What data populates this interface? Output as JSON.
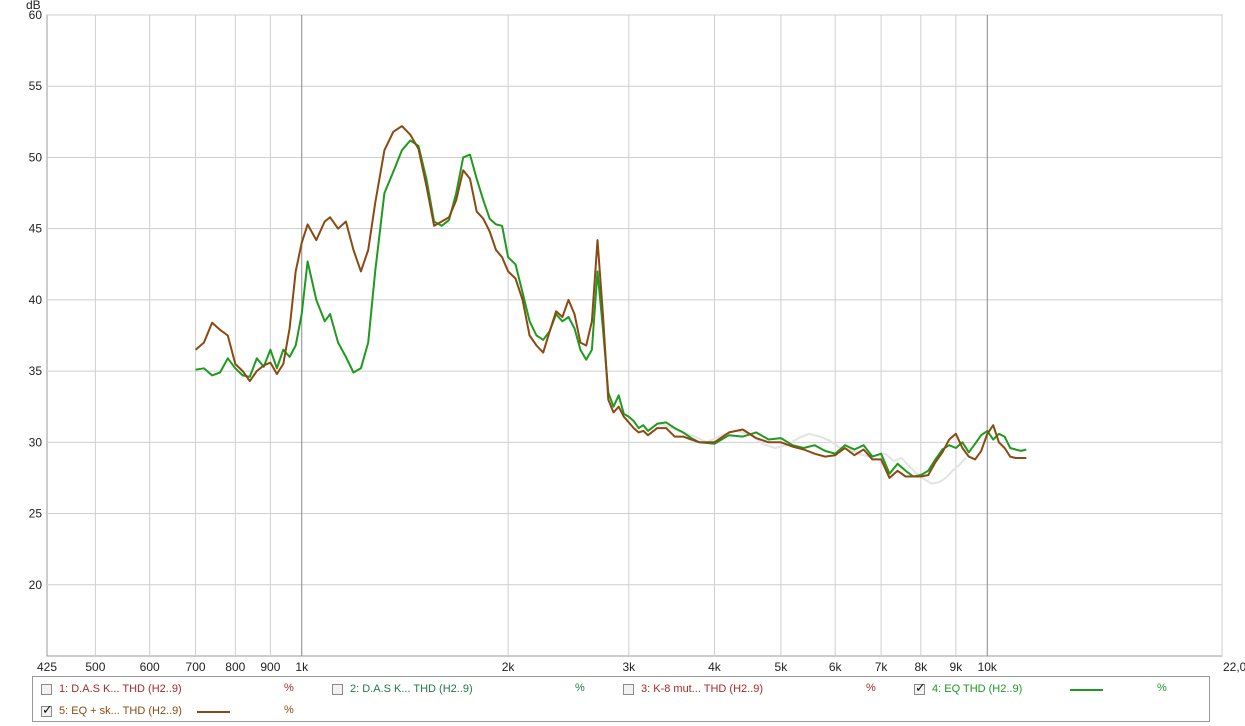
{
  "chart_data": {
    "type": "line",
    "ylabel": "dB",
    "ylim": [
      15,
      60
    ],
    "xlim": [
      425,
      22000
    ],
    "x_scale": "log",
    "grid": true,
    "y_ticks": [
      20,
      25,
      30,
      35,
      40,
      45,
      50,
      55,
      60
    ],
    "x_ticks": [
      {
        "value": 425,
        "label": "425"
      },
      {
        "value": 500,
        "label": "500"
      },
      {
        "value": 600,
        "label": "600"
      },
      {
        "value": 700,
        "label": "700"
      },
      {
        "value": 800,
        "label": "800"
      },
      {
        "value": 900,
        "label": "900"
      },
      {
        "value": 1000,
        "label": "1k"
      },
      {
        "value": 2000,
        "label": "2k"
      },
      {
        "value": 3000,
        "label": "3k"
      },
      {
        "value": 4000,
        "label": "4k"
      },
      {
        "value": 5000,
        "label": "5k"
      },
      {
        "value": 6000,
        "label": "6k"
      },
      {
        "value": 7000,
        "label": "7k"
      },
      {
        "value": 8000,
        "label": "8k"
      },
      {
        "value": 9000,
        "label": "9k"
      },
      {
        "value": 10000,
        "label": "10k"
      },
      {
        "value": 22000,
        "label": "22,0kHz"
      }
    ],
    "series": [
      {
        "name": "4: EQ THD (H2..9)",
        "color": "#1f9a1f",
        "x": [
          700,
          720,
          740,
          760,
          780,
          800,
          820,
          840,
          860,
          880,
          900,
          920,
          940,
          960,
          980,
          1000,
          1020,
          1050,
          1080,
          1100,
          1130,
          1160,
          1190,
          1220,
          1250,
          1280,
          1320,
          1360,
          1400,
          1440,
          1480,
          1520,
          1560,
          1600,
          1640,
          1680,
          1720,
          1760,
          1800,
          1840,
          1880,
          1920,
          1960,
          2000,
          2050,
          2100,
          2150,
          2200,
          2250,
          2300,
          2350,
          2400,
          2450,
          2500,
          2550,
          2600,
          2650,
          2700,
          2750,
          2800,
          2850,
          2900,
          2950,
          3000,
          3050,
          3100,
          3150,
          3200,
          3300,
          3400,
          3500,
          3600,
          3700,
          3800,
          4000,
          4200,
          4400,
          4600,
          4800,
          5000,
          5200,
          5400,
          5600,
          5800,
          6000,
          6200,
          6400,
          6600,
          6800,
          7000,
          7200,
          7400,
          7600,
          7800,
          8000,
          8200,
          8400,
          8600,
          8800,
          9000,
          9200,
          9400,
          9600,
          9800,
          10000,
          10200,
          10400,
          10600,
          10800,
          11000,
          11200,
          11400
        ],
        "y": [
          35.1,
          35.2,
          34.7,
          34.9,
          35.9,
          35.2,
          34.7,
          34.6,
          35.9,
          35.3,
          36.5,
          35.2,
          36.5,
          36.0,
          36.8,
          39.0,
          42.7,
          40.0,
          38.5,
          39.0,
          37.0,
          36.0,
          34.9,
          35.2,
          37.0,
          42.0,
          47.5,
          49.0,
          50.5,
          51.2,
          50.8,
          48.5,
          45.5,
          45.2,
          45.6,
          47.5,
          50.0,
          50.2,
          48.5,
          47.0,
          45.7,
          45.3,
          45.2,
          43.0,
          42.5,
          40.5,
          38.5,
          37.5,
          37.2,
          37.8,
          39.0,
          38.5,
          38.8,
          38.0,
          36.5,
          35.8,
          36.5,
          42.0,
          38.0,
          33.5,
          32.5,
          33.3,
          32.0,
          31.8,
          31.5,
          31.0,
          31.2,
          30.8,
          31.3,
          31.4,
          31.0,
          30.7,
          30.3,
          30.0,
          29.9,
          30.5,
          30.4,
          30.7,
          30.2,
          30.3,
          29.8,
          29.6,
          29.8,
          29.4,
          29.2,
          29.8,
          29.5,
          29.8,
          29.0,
          29.2,
          27.8,
          28.5,
          28.0,
          27.6,
          27.7,
          28.0,
          28.8,
          29.5,
          29.8,
          29.6,
          30.0,
          29.3,
          29.9,
          30.5,
          30.8,
          30.2,
          30.6,
          30.4,
          29.6,
          29.5,
          29.4,
          29.5
        ]
      },
      {
        "name": "5: EQ + sk... THD (H2..9)",
        "color": "#8b4a12",
        "x": [
          700,
          720,
          740,
          760,
          780,
          800,
          820,
          840,
          860,
          880,
          900,
          920,
          940,
          960,
          980,
          1000,
          1020,
          1050,
          1080,
          1100,
          1130,
          1160,
          1190,
          1220,
          1250,
          1280,
          1320,
          1360,
          1400,
          1440,
          1480,
          1520,
          1560,
          1600,
          1640,
          1680,
          1720,
          1760,
          1800,
          1840,
          1880,
          1920,
          1960,
          2000,
          2050,
          2100,
          2150,
          2200,
          2250,
          2300,
          2350,
          2400,
          2450,
          2500,
          2550,
          2600,
          2650,
          2700,
          2750,
          2800,
          2850,
          2900,
          2950,
          3000,
          3050,
          3100,
          3150,
          3200,
          3300,
          3400,
          3500,
          3600,
          3700,
          3800,
          4000,
          4200,
          4400,
          4600,
          4800,
          5000,
          5200,
          5400,
          5600,
          5800,
          6000,
          6200,
          6400,
          6600,
          6800,
          7000,
          7200,
          7400,
          7600,
          7800,
          8000,
          8200,
          8400,
          8600,
          8800,
          9000,
          9200,
          9400,
          9600,
          9800,
          10000,
          10200,
          10400,
          10600,
          10800,
          11000,
          11200,
          11400
        ],
        "y": [
          36.5,
          37.0,
          38.4,
          37.9,
          37.5,
          35.5,
          35.0,
          34.3,
          35.0,
          35.4,
          35.6,
          34.8,
          35.5,
          38.0,
          42.0,
          44.0,
          45.3,
          44.2,
          45.5,
          45.8,
          45.0,
          45.5,
          43.5,
          42.0,
          43.5,
          46.8,
          50.5,
          51.8,
          52.2,
          51.6,
          50.6,
          48.0,
          45.2,
          45.5,
          45.8,
          47.0,
          49.1,
          48.5,
          46.2,
          45.7,
          44.8,
          43.5,
          43.0,
          42.0,
          41.5,
          40.0,
          37.5,
          36.8,
          36.3,
          37.8,
          39.2,
          38.8,
          40.0,
          39.0,
          37.0,
          36.8,
          38.5,
          44.2,
          39.0,
          33.0,
          32.1,
          32.5,
          31.8,
          31.4,
          31.0,
          30.7,
          30.8,
          30.5,
          31.0,
          31.0,
          30.4,
          30.4,
          30.2,
          30.0,
          30.0,
          30.7,
          30.9,
          30.3,
          30.0,
          30.0,
          29.7,
          29.5,
          29.2,
          29.0,
          29.1,
          29.6,
          29.1,
          29.5,
          28.8,
          28.8,
          27.5,
          28.0,
          27.6,
          27.6,
          27.6,
          27.7,
          28.6,
          29.3,
          30.2,
          30.6,
          29.6,
          29.0,
          28.8,
          29.4,
          30.6,
          31.2,
          30.0,
          29.6,
          29.0,
          28.9,
          28.9,
          28.9
        ]
      },
      {
        "color": "#e3e3e3",
        "x": [
          3300,
          3500,
          3700,
          3900,
          4100,
          4300,
          4500,
          4700,
          4900,
          5100,
          5300,
          5500,
          5700,
          5900,
          6100,
          6300,
          6500,
          6700,
          6900,
          7100,
          7300,
          7500,
          7700,
          7900,
          8100,
          8300,
          8500,
          8700,
          8900,
          9100,
          9300
        ],
        "y": [
          31.4,
          30.9,
          30.5,
          30.0,
          30.5,
          30.8,
          30.6,
          29.9,
          29.6,
          29.8,
          30.3,
          30.6,
          30.4,
          30.1,
          29.6,
          29.5,
          29.2,
          29.0,
          29.1,
          29.2,
          28.7,
          28.9,
          28.3,
          27.8,
          27.4,
          27.1,
          27.2,
          27.5,
          28.0,
          28.4,
          28.9
        ]
      }
    ]
  },
  "legend": {
    "items": [
      {
        "label": "1: D.A.S K... THD (H2..9)",
        "unit": "%",
        "checked": false,
        "color": "#a52a2a"
      },
      {
        "label": "2: D.A.S K... THD (H2..9)",
        "unit": "%",
        "checked": false,
        "color": "#1e7a4a"
      },
      {
        "label": "3: K-8 mut... THD (H2..9)",
        "unit": "%",
        "checked": false,
        "color": "#a52a2a"
      },
      {
        "label": "4: EQ THD (H2..9)",
        "unit": "%",
        "checked": true,
        "color": "#1f9a1f"
      },
      {
        "label": "5: EQ + sk... THD (H2..9)",
        "unit": "%",
        "checked": true,
        "color": "#8b4a12"
      }
    ]
  }
}
